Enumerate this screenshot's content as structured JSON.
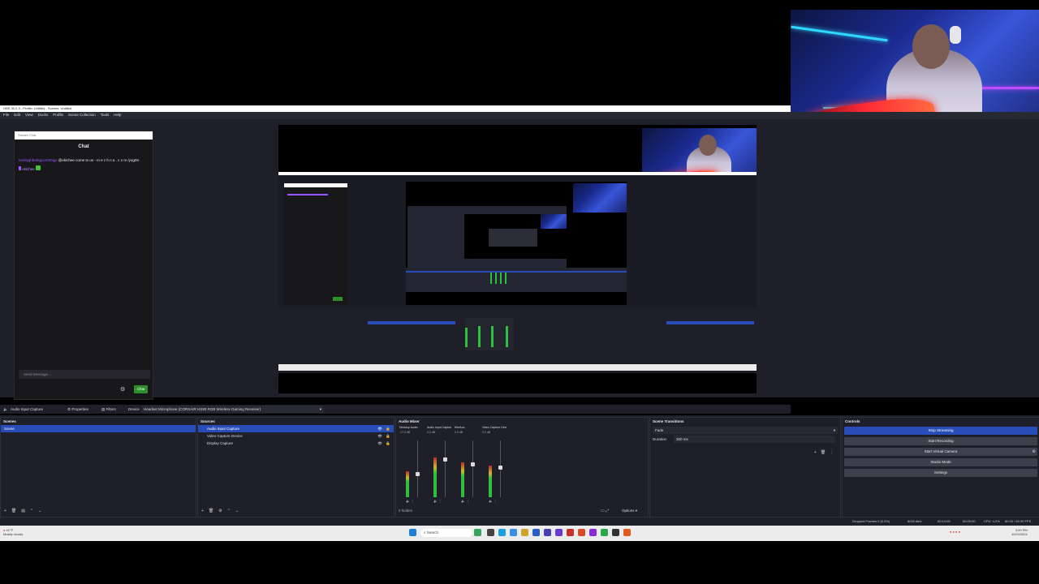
{
  "window": {
    "title": "OBS 30.2.3 - Profile: Untitled - Scenes: Untitled",
    "menu": [
      "File",
      "Edit",
      "View",
      "Docks",
      "Profile",
      "Scene Collection",
      "Tools",
      "Help"
    ]
  },
  "chat": {
    "popout_label": "Stream Chat",
    "title": "Chat",
    "messages": [
      {
        "user": "lonelyghbarkgcomtrbigz",
        "text": "@ekichee come to us - m e z h n a . c o m /yogDs",
        "user_color": "#9b59ff"
      },
      {
        "user": "ekichee",
        "text": "",
        "user_color": "#9b59ff"
      }
    ],
    "input_placeholder": "Send message...",
    "send_label": "Chat"
  },
  "source_toolbar": {
    "source_name": "Audio Input Capture",
    "properties_label": "Properties",
    "filters_label": "Filters",
    "device_label": "Device",
    "device_value": "Headset Microphone (CORSAIR HS80 RGB Wireless Gaming Receiver)"
  },
  "scenes": {
    "title": "Scenes",
    "items": [
      "Scene"
    ]
  },
  "sources": {
    "title": "Sources",
    "items": [
      "Audio Input Capture",
      "Video Capture Device",
      "Display Capture"
    ]
  },
  "audio_mixer": {
    "title": "Audio Mixer",
    "channels": [
      {
        "name": "Desktop Audio",
        "db": "-17.4 dB",
        "level": 0.45
      },
      {
        "name": "Audio Input Capture",
        "db": "0.0 dB",
        "level": 0.7
      },
      {
        "name": "Mic/Aux",
        "db": "0.0 dB",
        "level": 0.62
      },
      {
        "name": "Video Capture Device",
        "db": "0.0 dB",
        "level": 0.55
      }
    ],
    "footer_label": "0 hidden",
    "options_label": "Options"
  },
  "transitions": {
    "title": "Scene Transitions",
    "type_value": "Fade",
    "duration_label": "Duration",
    "duration_value": "300 ms"
  },
  "controls": {
    "title": "Controls",
    "buttons": [
      "Stop Streaming",
      "Start Recording",
      "Start Virtual Camera",
      "Studio Mode",
      "Settings"
    ]
  },
  "statusbar": {
    "dropped": "Dropped Frames 0 (0.0%)",
    "bitrate": "6026 kb/s",
    "stream_time": "00:14:05",
    "rec_time": "00:00:00",
    "cpu": "CPU: 4.2%",
    "fps": "60.00 / 60.00 FPS"
  },
  "taskbar": {
    "weather_temp": "41°F",
    "weather_desc": "Mostly cloudy",
    "search_label": "Search",
    "clock_time": "3:09 PM",
    "clock_date": "11/24/2024"
  },
  "colors": {
    "accent": "#284cb8",
    "panel_bg": "#1e1f29",
    "chat_send": "#2e8f2e"
  }
}
